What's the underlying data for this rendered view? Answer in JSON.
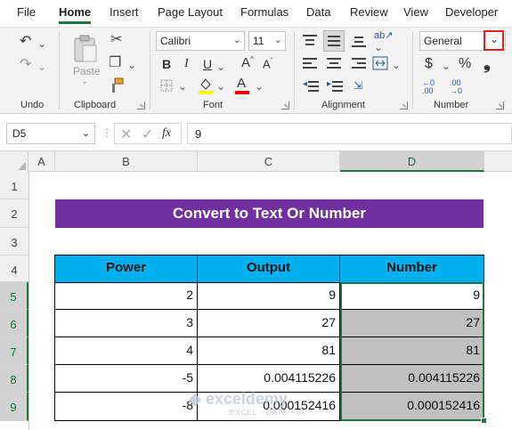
{
  "menu": {
    "tabs": [
      {
        "label": "File"
      },
      {
        "label": "Home"
      },
      {
        "label": "Insert"
      },
      {
        "label": "Page Layout"
      },
      {
        "label": "Formulas"
      },
      {
        "label": "Data"
      },
      {
        "label": "Review"
      },
      {
        "label": "View"
      },
      {
        "label": "Developer"
      }
    ],
    "active": "Home"
  },
  "ribbon": {
    "groups": {
      "undo": "Undo",
      "clipboard": "Clipboard",
      "font": "Font",
      "alignment": "Alignment",
      "number": "Number"
    },
    "paste_label": "Paste",
    "font_name": "Calibri",
    "font_size": "11",
    "number_format": "General",
    "icons": {
      "undo": "undo-icon",
      "redo": "redo-icon",
      "paste": "paste-icon",
      "cut": "cut-icon",
      "copy": "copy-icon",
      "format-painter": "format-painter-icon",
      "bold": "bold-icon",
      "italic": "italic-icon",
      "underline": "underline-icon",
      "borders": "borders-icon",
      "fill-color": "fill-color-icon",
      "font-color": "font-color-icon",
      "currency": "currency-icon",
      "percent": "percent-icon",
      "comma": "comma-style-icon"
    },
    "accent_colors": {
      "fill": "#ffff00",
      "font": "#ff0000",
      "highlight_box": "#e02020"
    }
  },
  "formula_bar": {
    "name_box": "D5",
    "value": "9",
    "fx_label": "fx"
  },
  "grid": {
    "columns": [
      "A",
      "B",
      "C",
      "D"
    ],
    "selected_column": "D",
    "rows": [
      "1",
      "2",
      "3",
      "4",
      "5",
      "6",
      "7",
      "8",
      "9"
    ],
    "selected_rows": [
      "5",
      "6",
      "7",
      "8",
      "9"
    ],
    "title": "Convert to Text Or Number",
    "table": {
      "headers": [
        "Power",
        "Output",
        "Number"
      ],
      "rows": [
        [
          "2",
          "9",
          "9"
        ],
        [
          "3",
          "27",
          "27"
        ],
        [
          "4",
          "81",
          "81"
        ],
        [
          "-5",
          "0.004115226",
          "0.004115226"
        ],
        [
          "-8",
          "0.000152416",
          "0.000152416"
        ]
      ]
    },
    "colors": {
      "header_fill": "#00b0f0",
      "title_fill": "#7030a0",
      "shaded_fill": "#c0c0c0",
      "selection": "#217346"
    }
  },
  "watermark": {
    "name": "exceldemy",
    "sub": "EXCEL · DATA · BI"
  }
}
